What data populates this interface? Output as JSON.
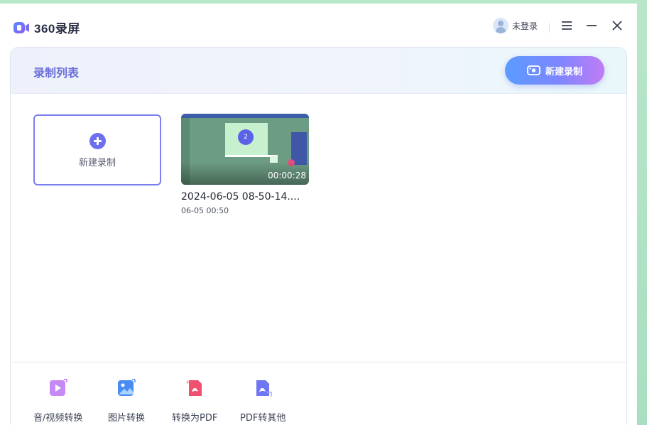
{
  "app": {
    "title": "360录屏",
    "user_label": "未登录"
  },
  "panel": {
    "title": "录制列表",
    "new_recording_button": "新建录制"
  },
  "new_card": {
    "label": "新建录制"
  },
  "recordings": [
    {
      "name": "2024-06-05 08-50-14....",
      "date": "06-05 00:50",
      "duration": "00:00:28",
      "thumb_badge": "2"
    }
  ],
  "tools": [
    {
      "label": "音/视频转换",
      "icon": "video-convert-icon",
      "color": "#b76cf0"
    },
    {
      "label": "图片转换",
      "icon": "image-convert-icon",
      "color": "#4a8cf5"
    },
    {
      "label": "转换为PDF",
      "icon": "to-pdf-icon",
      "color": "#f0506e"
    },
    {
      "label": "PDF转其他",
      "icon": "pdf-to-other-icon",
      "color": "#6b6ff2"
    }
  ],
  "colors": {
    "accent": "#6c6ff0",
    "title_purple": "#6a6fd8"
  }
}
